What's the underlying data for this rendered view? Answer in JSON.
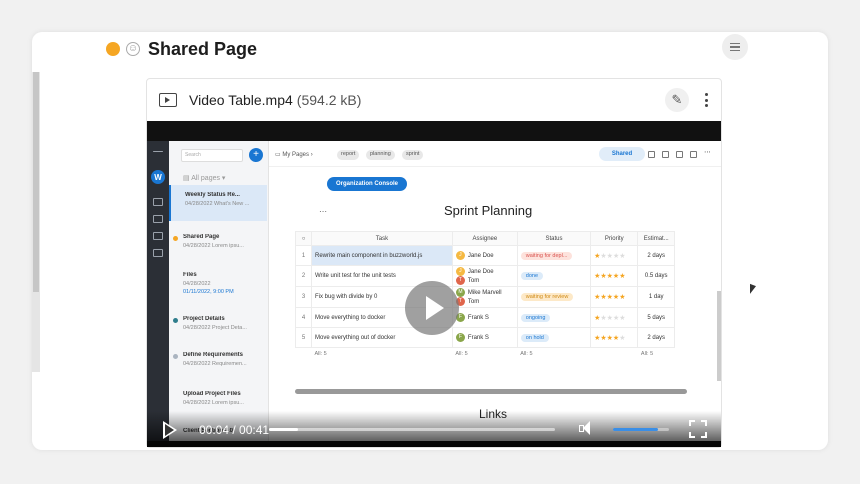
{
  "page": {
    "title": "Shared Page",
    "status_color": "#f5a623"
  },
  "file": {
    "name": "Video Table.mp4",
    "size": "(594.2 kB)",
    "icons": {
      "type": "video-file-icon",
      "edit": "pencil-icon",
      "more": "kebab-icon"
    }
  },
  "video": {
    "time": "00:04 / 00:41",
    "progress": 0.1,
    "volume": 0.8
  },
  "app": {
    "workspace_initial": "W",
    "search_placeholder": "Search",
    "all_pages": "All pages",
    "pages": [
      {
        "title": "Weekly Status Re...",
        "meta": "04/28/2022 What's New ...",
        "active": true,
        "dot": ""
      },
      {
        "title": "Shared Page",
        "meta": "04/28/2022 Lorem ipsu...",
        "dot": "#f5a623"
      },
      {
        "title": "Files",
        "meta": "04/28/2022",
        "meta2": "01/11/2022, 9:00 PM",
        "dot": ""
      },
      {
        "title": "Project Details",
        "meta": "04/28/2022 Project Deta...",
        "dot": "#2e7d8c"
      },
      {
        "title": "Define Requirements",
        "meta": "04/28/2022 Requiremen...",
        "dot": "#aab4c0"
      },
      {
        "title": "Upload Project Files",
        "meta": "04/28/2022 Lorem ipsu...",
        "dot": ""
      },
      {
        "title": "Client Section 2.0",
        "meta": "",
        "dot": ""
      }
    ],
    "breadcrumb": "My Pages",
    "tags": [
      "report",
      "planning",
      "sprint"
    ],
    "shared_label": "Shared",
    "org_button": "Organization Console",
    "doc_title": "Sprint Planning",
    "columns": [
      "Task",
      "Assignee",
      "Status",
      "Priority",
      "Estimat..."
    ],
    "rows": [
      {
        "n": "1",
        "task": "Rewrite main component in buzzworld.js",
        "assignees": [
          [
            "J",
            "Jane Doe",
            "#f5b942"
          ]
        ],
        "status": "waiting for depl...",
        "status_bg": "#fde2dc",
        "status_fg": "#d9534f",
        "stars": 1,
        "estimate": "2 days"
      },
      {
        "n": "2",
        "task": "Write unit test for the unit tests",
        "assignees": [
          [
            "J",
            "Jane Doe",
            "#f5b942"
          ],
          [
            "T",
            "Tom",
            "#e0664c"
          ]
        ],
        "status": "done",
        "status_bg": "#dcebf9",
        "status_fg": "#1976d2",
        "stars": 5,
        "estimate": "0.5 days"
      },
      {
        "n": "3",
        "task": "Fix bug with divide by 0",
        "assignees": [
          [
            "M",
            "Mike Marvell",
            "#8aa64a"
          ],
          [
            "T",
            "Tom",
            "#e0664c"
          ]
        ],
        "status": "waiting for review",
        "status_bg": "#fde9c8",
        "status_fg": "#d08a14",
        "stars": 5,
        "estimate": "1 day"
      },
      {
        "n": "4",
        "task": "Move everything to docker",
        "assignees": [
          [
            "F",
            "Frank S",
            "#8aa64a"
          ]
        ],
        "status": "ongoing",
        "status_bg": "#dcebf9",
        "status_fg": "#1976d2",
        "stars": 1,
        "estimate": "5 days"
      },
      {
        "n": "5",
        "task": "Move everything out of docker",
        "assignees": [
          [
            "F",
            "Frank S",
            "#8aa64a"
          ]
        ],
        "status": "on hold",
        "status_bg": "#dcebf9",
        "status_fg": "#1976d2",
        "stars": 4,
        "estimate": "2 days"
      }
    ],
    "footer": [
      "All: 5",
      "All: 5",
      "All: 5",
      "All: 5"
    ],
    "links_title": "Links"
  }
}
